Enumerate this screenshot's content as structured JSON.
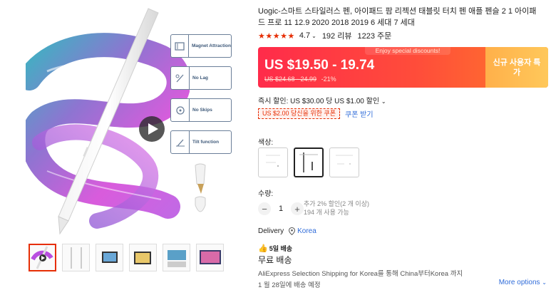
{
  "gallery": {
    "features": [
      {
        "label": "Magnet Attraction",
        "icon": "magnet-icon"
      },
      {
        "label": "No Lag",
        "icon": "no-lag-icon"
      },
      {
        "label": "No Skips",
        "icon": "no-skips-icon"
      },
      {
        "label": "Tilt function",
        "icon": "tilt-icon"
      }
    ],
    "thumbnails": [
      {
        "label": "",
        "active": true
      },
      {
        "label": "",
        "active": false
      },
      {
        "label": "",
        "active": false
      },
      {
        "label": "",
        "active": false
      },
      {
        "label": "",
        "active": false
      },
      {
        "label": "",
        "active": false
      }
    ]
  },
  "product": {
    "title": "Uogic-스마트 스타일러스 펜, 아이패드 팜 리젝션 태블릿 터치 펜 애플 펜슬 2 1 아이패드 프로 11 12.9 2020 2018 2019 6 세대 7 세대",
    "rating": "4.7",
    "reviews": "192 리뷰",
    "orders": "1223 주문"
  },
  "price": {
    "banner": "Enjoy special discounts!",
    "current": "US $19.50 - 19.74",
    "original": "US $24.68 - 24.99",
    "discount": "-21%",
    "new_user": "신규 사용자 특가"
  },
  "promo": {
    "instant": "즉시 할인: US $30.00 당 US $1.00 할인",
    "coupon": "US $2.00 당신을 위한 쿠폰",
    "get_coupon": "쿠폰 받기"
  },
  "options": {
    "color_label": "색상:",
    "quantity_label": "수량:",
    "quantity": "1",
    "qty_note_1": "추가 2% 할인(2 개 이상)",
    "qty_note_2": "194 개 사용 가능"
  },
  "shipping": {
    "delivery_label": "Delivery",
    "location": "Korea",
    "badge": "5일 배송",
    "free": "무료 배송",
    "desc": "AliExpress Selection Shipping for Korea를 통해 China부터Korea 까지",
    "date": "1 월 28일에 배송 예정",
    "more": "More options"
  },
  "colors": {
    "accent": "#e62e04",
    "link": "#2e6bd9"
  }
}
